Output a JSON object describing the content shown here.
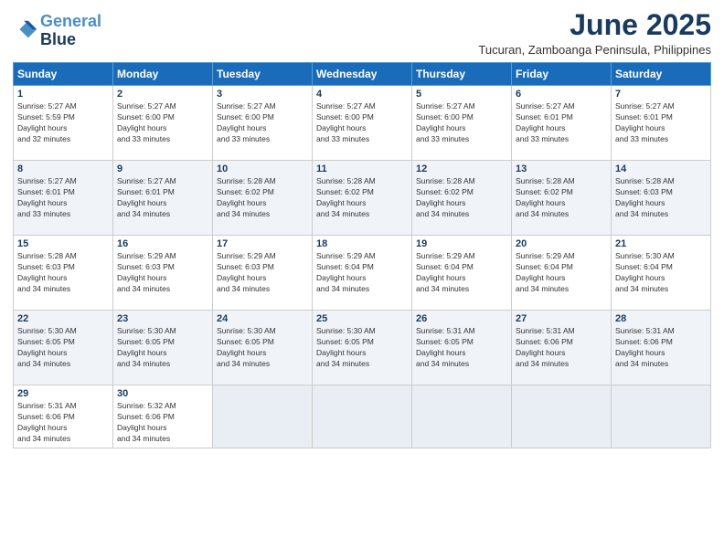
{
  "logo": {
    "line1": "General",
    "line2": "Blue"
  },
  "title": "June 2025",
  "subtitle": "Tucuran, Zamboanga Peninsula, Philippines",
  "header_days": [
    "Sunday",
    "Monday",
    "Tuesday",
    "Wednesday",
    "Thursday",
    "Friday",
    "Saturday"
  ],
  "weeks": [
    [
      {
        "day": "1",
        "rise": "5:27 AM",
        "set": "5:59 PM",
        "hours": "12 hours and 32 minutes"
      },
      {
        "day": "2",
        "rise": "5:27 AM",
        "set": "6:00 PM",
        "hours": "12 hours and 33 minutes"
      },
      {
        "day": "3",
        "rise": "5:27 AM",
        "set": "6:00 PM",
        "hours": "12 hours and 33 minutes"
      },
      {
        "day": "4",
        "rise": "5:27 AM",
        "set": "6:00 PM",
        "hours": "12 hours and 33 minutes"
      },
      {
        "day": "5",
        "rise": "5:27 AM",
        "set": "6:00 PM",
        "hours": "12 hours and 33 minutes"
      },
      {
        "day": "6",
        "rise": "5:27 AM",
        "set": "6:01 PM",
        "hours": "12 hours and 33 minutes"
      },
      {
        "day": "7",
        "rise": "5:27 AM",
        "set": "6:01 PM",
        "hours": "12 hours and 33 minutes"
      }
    ],
    [
      {
        "day": "8",
        "rise": "5:27 AM",
        "set": "6:01 PM",
        "hours": "12 hours and 33 minutes"
      },
      {
        "day": "9",
        "rise": "5:27 AM",
        "set": "6:01 PM",
        "hours": "12 hours and 34 minutes"
      },
      {
        "day": "10",
        "rise": "5:28 AM",
        "set": "6:02 PM",
        "hours": "12 hours and 34 minutes"
      },
      {
        "day": "11",
        "rise": "5:28 AM",
        "set": "6:02 PM",
        "hours": "12 hours and 34 minutes"
      },
      {
        "day": "12",
        "rise": "5:28 AM",
        "set": "6:02 PM",
        "hours": "12 hours and 34 minutes"
      },
      {
        "day": "13",
        "rise": "5:28 AM",
        "set": "6:02 PM",
        "hours": "12 hours and 34 minutes"
      },
      {
        "day": "14",
        "rise": "5:28 AM",
        "set": "6:03 PM",
        "hours": "12 hours and 34 minutes"
      }
    ],
    [
      {
        "day": "15",
        "rise": "5:28 AM",
        "set": "6:03 PM",
        "hours": "12 hours and 34 minutes"
      },
      {
        "day": "16",
        "rise": "5:29 AM",
        "set": "6:03 PM",
        "hours": "12 hours and 34 minutes"
      },
      {
        "day": "17",
        "rise": "5:29 AM",
        "set": "6:03 PM",
        "hours": "12 hours and 34 minutes"
      },
      {
        "day": "18",
        "rise": "5:29 AM",
        "set": "6:04 PM",
        "hours": "12 hours and 34 minutes"
      },
      {
        "day": "19",
        "rise": "5:29 AM",
        "set": "6:04 PM",
        "hours": "12 hours and 34 minutes"
      },
      {
        "day": "20",
        "rise": "5:29 AM",
        "set": "6:04 PM",
        "hours": "12 hours and 34 minutes"
      },
      {
        "day": "21",
        "rise": "5:30 AM",
        "set": "6:04 PM",
        "hours": "12 hours and 34 minutes"
      }
    ],
    [
      {
        "day": "22",
        "rise": "5:30 AM",
        "set": "6:05 PM",
        "hours": "12 hours and 34 minutes"
      },
      {
        "day": "23",
        "rise": "5:30 AM",
        "set": "6:05 PM",
        "hours": "12 hours and 34 minutes"
      },
      {
        "day": "24",
        "rise": "5:30 AM",
        "set": "6:05 PM",
        "hours": "12 hours and 34 minutes"
      },
      {
        "day": "25",
        "rise": "5:30 AM",
        "set": "6:05 PM",
        "hours": "12 hours and 34 minutes"
      },
      {
        "day": "26",
        "rise": "5:31 AM",
        "set": "6:05 PM",
        "hours": "12 hours and 34 minutes"
      },
      {
        "day": "27",
        "rise": "5:31 AM",
        "set": "6:06 PM",
        "hours": "12 hours and 34 minutes"
      },
      {
        "day": "28",
        "rise": "5:31 AM",
        "set": "6:06 PM",
        "hours": "12 hours and 34 minutes"
      }
    ],
    [
      {
        "day": "29",
        "rise": "5:31 AM",
        "set": "6:06 PM",
        "hours": "12 hours and 34 minutes"
      },
      {
        "day": "30",
        "rise": "5:32 AM",
        "set": "6:06 PM",
        "hours": "12 hours and 34 minutes"
      },
      null,
      null,
      null,
      null,
      null
    ]
  ]
}
